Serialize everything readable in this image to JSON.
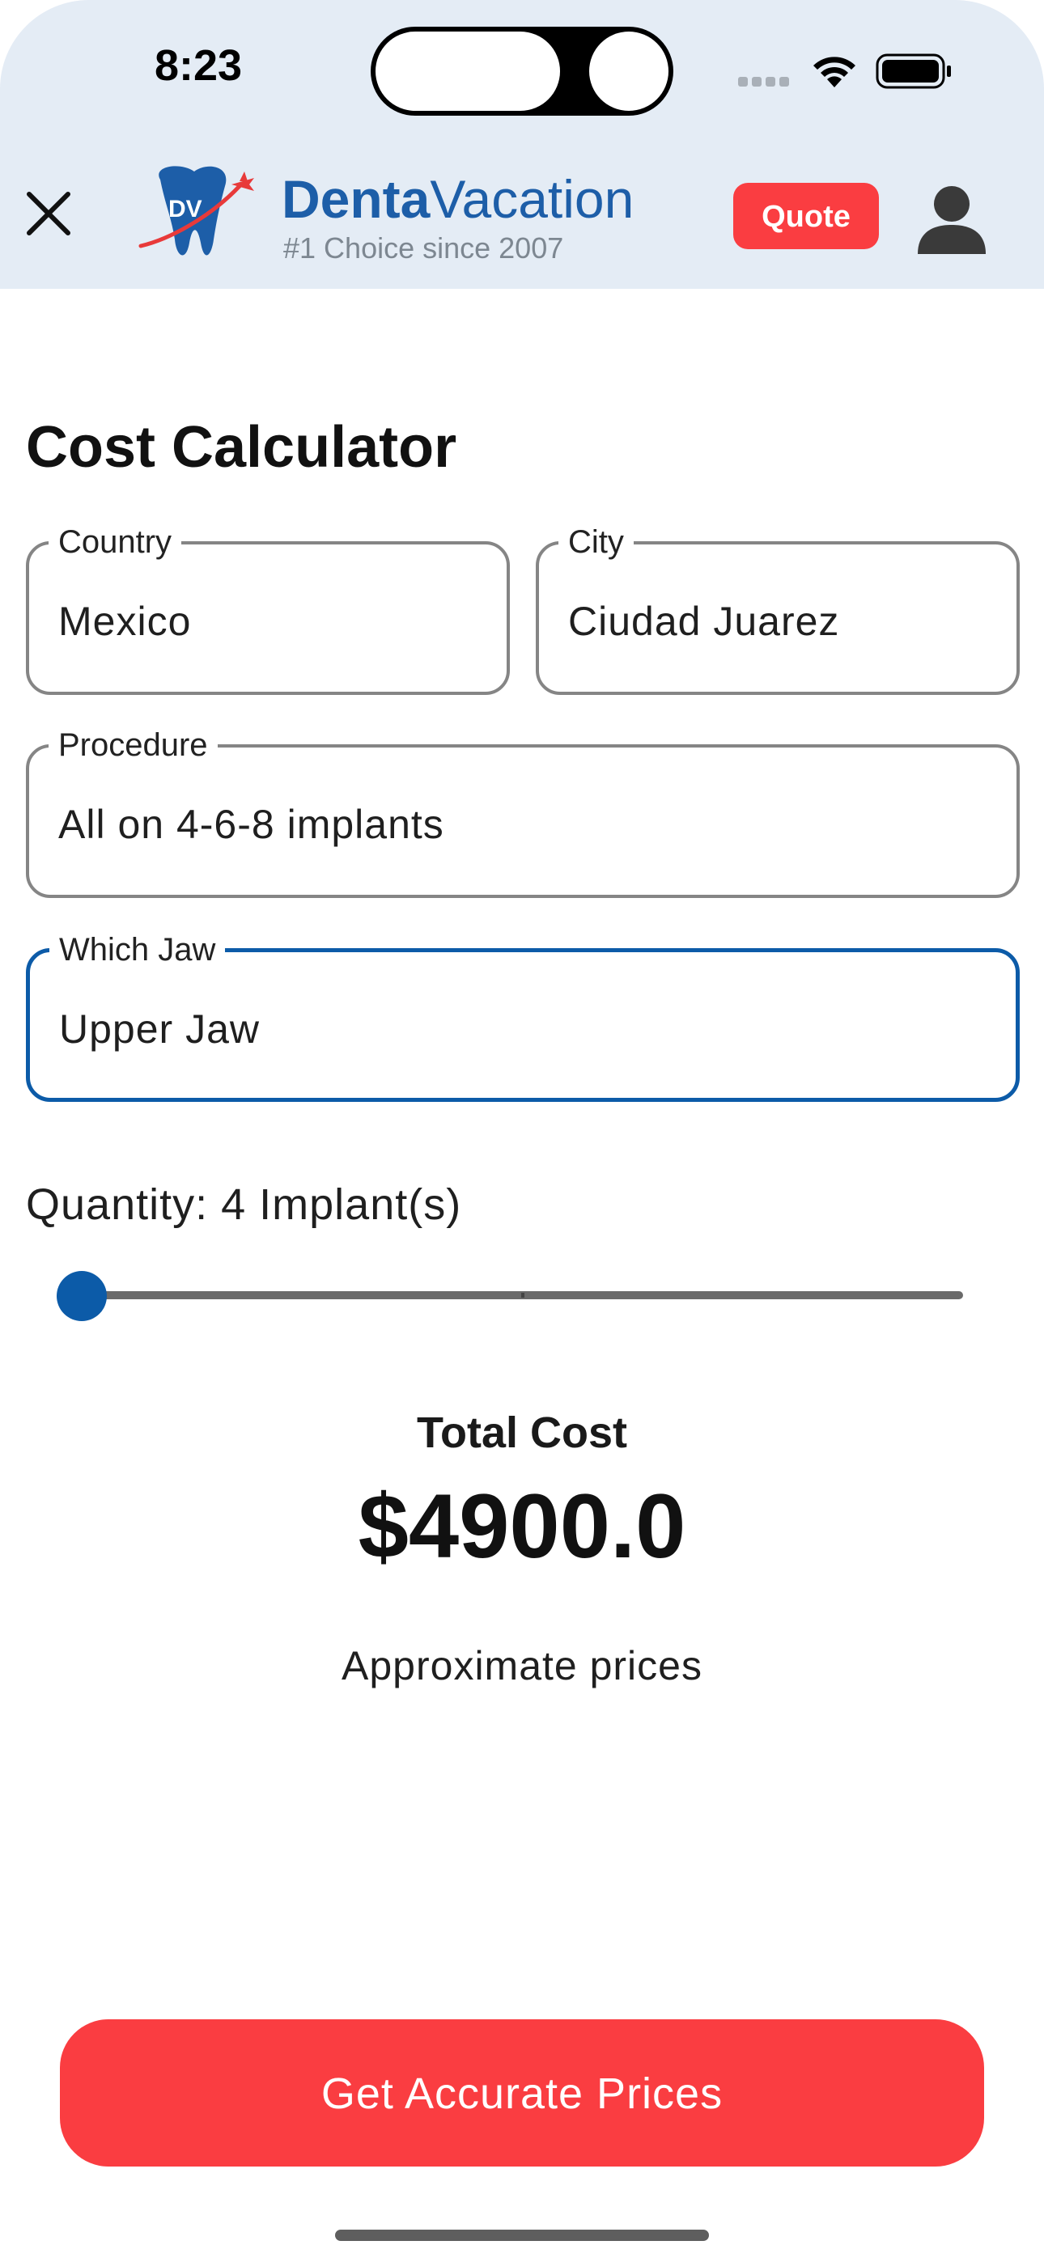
{
  "status_bar": {
    "time": "8:23",
    "icons": [
      "signal-icon",
      "wifi-icon",
      "battery-icon"
    ]
  },
  "header": {
    "close_icon": "close-icon",
    "logo_initials": "DV",
    "brand_bold": "Denta",
    "brand_regular": "Vacation",
    "tagline": "#1 Choice since 2007",
    "quote_label": "Quote",
    "profile_icon": "profile-icon"
  },
  "main": {
    "title": "Cost Calculator",
    "fields": {
      "country": {
        "label": "Country",
        "value": "Mexico"
      },
      "city": {
        "label": "City",
        "value": "Ciudad Juarez"
      },
      "procedure": {
        "label": "Procedure",
        "value": "All on 4-6-8 implants"
      },
      "jaw": {
        "label": "Which Jaw",
        "value": "Upper Jaw"
      }
    },
    "quantity_label": "Quantity: 4 Implant(s)",
    "slider_position": 0,
    "total_label": "Total Cost",
    "total_value": "$4900.0",
    "approx_note": "Approximate prices",
    "cta_label": "Get Accurate Prices"
  },
  "colors": {
    "header_bg": "#e4ecf5",
    "brand_blue": "#1d5ea8",
    "accent_red": "#fa3d41",
    "focus_blue": "#0c5ba8"
  }
}
